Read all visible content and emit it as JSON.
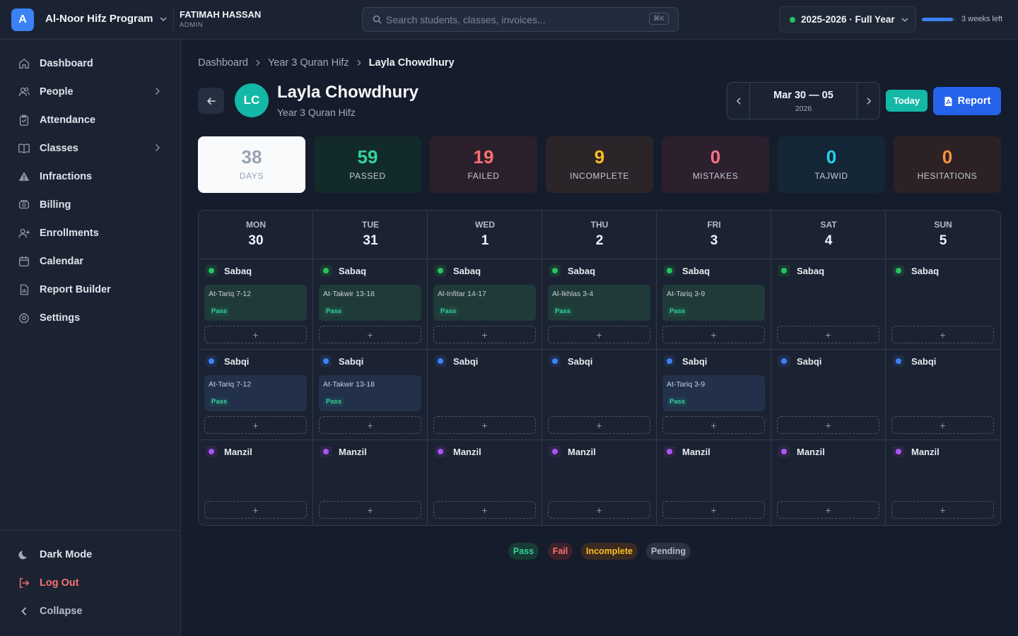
{
  "topbar": {
    "logo_letter": "A",
    "program": "Al-Noor Hifz Program",
    "user_name": "FATIMAH HASSAN",
    "user_role": "ADMIN",
    "search_placeholder": "Search students, classes, invoices...",
    "search_shortcut": "⌘K",
    "year": "2025-2026 · Full Year",
    "year_progress": 0.92,
    "weeks_left": "3 weeks left"
  },
  "sidebar": {
    "items": [
      {
        "label": "Dashboard",
        "icon": "home-icon"
      },
      {
        "label": "People",
        "icon": "users-icon",
        "expandable": true
      },
      {
        "label": "Attendance",
        "icon": "clipboard-check-icon"
      },
      {
        "label": "Classes",
        "icon": "book-icon",
        "expandable": true
      },
      {
        "label": "Infractions",
        "icon": "warning-icon"
      },
      {
        "label": "Billing",
        "icon": "billing-icon"
      },
      {
        "label": "Enrollments",
        "icon": "user-plus-icon"
      },
      {
        "label": "Calendar",
        "icon": "calendar-icon"
      },
      {
        "label": "Report Builder",
        "icon": "report-icon"
      },
      {
        "label": "Settings",
        "icon": "gear-icon"
      }
    ],
    "dark_mode": "Dark Mode",
    "logout": "Log Out",
    "collapse": "Collapse"
  },
  "breadcrumb": [
    "Dashboard",
    "Year 3 Quran Hifz",
    "Layla Chowdhury"
  ],
  "student": {
    "initials": "LC",
    "name": "Layla Chowdhury",
    "class": "Year 3 Quran Hifz"
  },
  "date_nav": {
    "range": "Mar 30 — 05",
    "year": "2026",
    "today": "Today",
    "report": "Report"
  },
  "stats": [
    {
      "value": "38",
      "label": "DAYS",
      "color": "#9aa3b2",
      "bg": "#f8fafc"
    },
    {
      "value": "59",
      "label": "PASSED",
      "color": "#34d399",
      "bg": "#132a2b"
    },
    {
      "value": "19",
      "label": "FAILED",
      "color": "#f87171",
      "bg": "#2c1f2c"
    },
    {
      "value": "9",
      "label": "INCOMPLETE",
      "color": "#fbbf24",
      "bg": "#2b2428"
    },
    {
      "value": "0",
      "label": "MISTAKES",
      "color": "#fb7185",
      "bg": "#2c1f2e"
    },
    {
      "value": "0",
      "label": "TAJWID",
      "color": "#22d3ee",
      "bg": "#152636"
    },
    {
      "value": "0",
      "label": "HESITATIONS",
      "color": "#fb923c",
      "bg": "#2c2226"
    }
  ],
  "days": [
    {
      "name": "MON",
      "num": "30"
    },
    {
      "name": "TUE",
      "num": "31"
    },
    {
      "name": "WED",
      "num": "1"
    },
    {
      "name": "THU",
      "num": "2"
    },
    {
      "name": "FRI",
      "num": "3"
    },
    {
      "name": "SAT",
      "num": "4"
    },
    {
      "name": "SUN",
      "num": "5"
    }
  ],
  "slots": [
    {
      "name": "Sabaq",
      "color": "#22c55e",
      "badge_bg": "#1c3a33",
      "entry_bg": "#1f3a38"
    },
    {
      "name": "Sabqi",
      "color": "#3b82f6",
      "badge_bg": "#1f2e4d",
      "entry_bg": "#22304a"
    },
    {
      "name": "Manzil",
      "color": "#a855f7",
      "badge_bg": "#2f2547",
      "entry_bg": "#2c2745"
    }
  ],
  "entries": {
    "sabaq": [
      "At-Tariq 7-12",
      "At-Takwir 13-18",
      "Al-Infitar 14-17",
      "Al-Ikhlas 3-4",
      "At-Tariq 3-9",
      "",
      ""
    ],
    "sabqi": [
      "At-Tariq 7-12",
      "At-Takwir 13-18",
      "",
      "",
      "At-Tariq 3-9",
      "",
      ""
    ],
    "manzil": [
      "",
      "",
      "",
      "",
      "",
      "",
      ""
    ]
  },
  "pass_label": "Pass",
  "add_label": "+",
  "legend": [
    {
      "label": "Pass",
      "color": "#34d399",
      "bg": "#173b34"
    },
    {
      "label": "Fail",
      "color": "#f87171",
      "bg": "#3c2229"
    },
    {
      "label": "Incomplete",
      "color": "#fbbf24",
      "bg": "#3a2a22"
    },
    {
      "label": "Pending",
      "color": "#b4bccb",
      "bg": "#2a3241"
    }
  ]
}
